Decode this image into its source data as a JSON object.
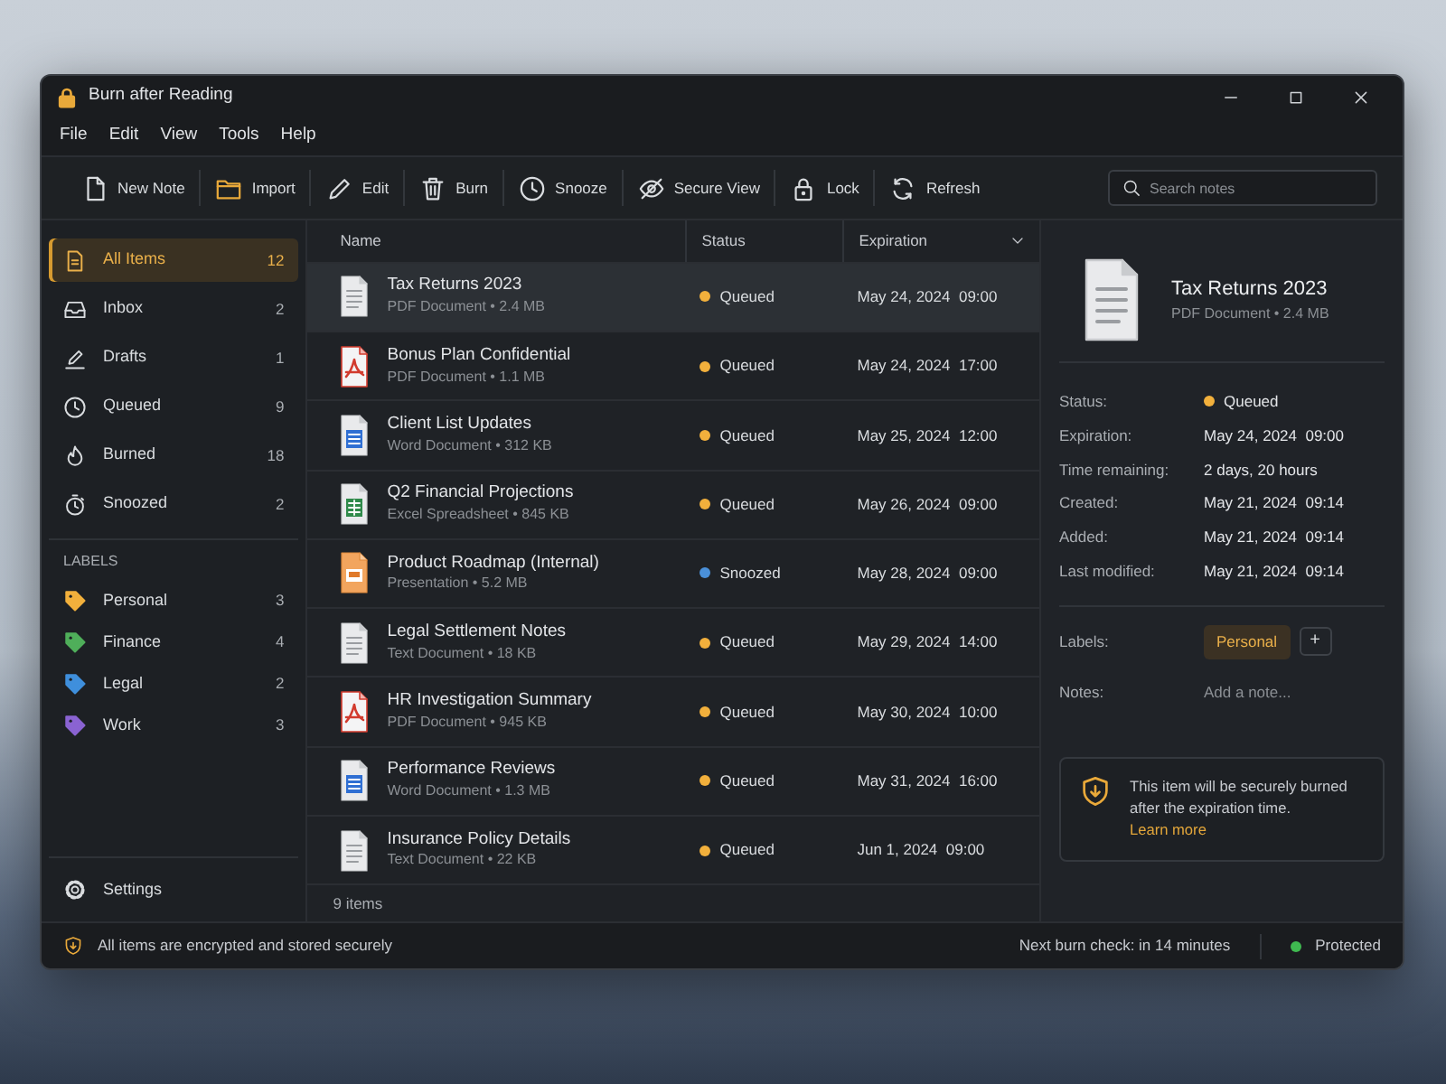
{
  "window": {
    "title": "Burn after Reading"
  },
  "menu": [
    "File",
    "Edit",
    "View",
    "Tools",
    "Help"
  ],
  "toolbar": [
    {
      "kind": "new",
      "label": "New Note"
    },
    {
      "kind": "import",
      "label": "Import"
    },
    {
      "kind": "edit",
      "label": "Edit"
    },
    {
      "kind": "burn",
      "label": "Burn"
    },
    {
      "kind": "snooze",
      "label": "Snooze"
    },
    {
      "kind": "secure",
      "label": "Secure View"
    },
    {
      "kind": "lock",
      "label": "Lock"
    },
    {
      "kind": "refresh",
      "label": "Refresh"
    }
  ],
  "search": {
    "placeholder": "Search notes"
  },
  "sidebar": {
    "items": [
      {
        "kind": "all",
        "label": "All Items",
        "count": "12",
        "selected": true
      },
      {
        "kind": "inbox",
        "label": "Inbox",
        "count": "2",
        "selected": false
      },
      {
        "kind": "drafts",
        "label": "Drafts",
        "count": "1",
        "selected": false
      },
      {
        "kind": "queued",
        "label": "Queued",
        "count": "9",
        "selected": false
      },
      {
        "kind": "burned",
        "label": "Burned",
        "count": "18",
        "selected": false
      },
      {
        "kind": "snoozed",
        "label": "Snoozed",
        "count": "2",
        "selected": false
      }
    ],
    "labels_heading": "LABELS",
    "labels": [
      {
        "label": "Personal",
        "count": "3",
        "color": "#f2b03c"
      },
      {
        "label": "Finance",
        "count": "4",
        "color": "#4fae5a"
      },
      {
        "label": "Legal",
        "count": "2",
        "color": "#3f8fdc"
      },
      {
        "label": "Work",
        "count": "3",
        "color": "#8a63d2"
      }
    ],
    "settings": "Settings"
  },
  "table": {
    "columns": [
      "Name",
      "Status",
      "Expiration"
    ],
    "rows": [
      {
        "kind": "plain",
        "name": "Tax Returns 2023",
        "meta": "PDF Document • 2.4 MB",
        "status": "Queued",
        "color": "#f2b03c",
        "expiration": "May 24, 2024  09:00",
        "selected": true
      },
      {
        "kind": "pdf",
        "name": "Bonus Plan Confidential",
        "meta": "PDF Document • 1.1 MB",
        "status": "Queued",
        "color": "#f2b03c",
        "expiration": "May 24, 2024  17:00",
        "selected": false
      },
      {
        "kind": "word",
        "name": "Client List Updates",
        "meta": "Word Document • 312 KB",
        "status": "Queued",
        "color": "#f2b03c",
        "expiration": "May 25, 2024  12:00",
        "selected": false
      },
      {
        "kind": "excel",
        "name": "Q2 Financial Projections",
        "meta": "Excel Spreadsheet • 845 KB",
        "status": "Queued",
        "color": "#f2b03c",
        "expiration": "May 26, 2024  09:00",
        "selected": false
      },
      {
        "kind": "slides",
        "name": "Product Roadmap (Internal)",
        "meta": "Presentation • 5.2 MB",
        "status": "Snoozed",
        "color": "#4a90d9",
        "expiration": "May 28, 2024  09:00",
        "selected": false
      },
      {
        "kind": "plain",
        "name": "Legal Settlement Notes",
        "meta": "Text Document • 18 KB",
        "status": "Queued",
        "color": "#f2b03c",
        "expiration": "May 29, 2024  14:00",
        "selected": false
      },
      {
        "kind": "pdf",
        "name": "HR Investigation Summary",
        "meta": "PDF Document • 945 KB",
        "status": "Queued",
        "color": "#f2b03c",
        "expiration": "May 30, 2024  10:00",
        "selected": false
      },
      {
        "kind": "word",
        "name": "Performance Reviews",
        "meta": "Word Document • 1.3 MB",
        "status": "Queued",
        "color": "#f2b03c",
        "expiration": "May 31, 2024  16:00",
        "selected": false
      },
      {
        "kind": "plain",
        "name": "Insurance Policy Details",
        "meta": "Text Document • 22 KB",
        "status": "Queued",
        "color": "#f2b03c",
        "expiration": "Jun 1, 2024  09:00",
        "selected": false
      }
    ],
    "footer": "9 items"
  },
  "details": {
    "kind": "plain",
    "title": "Tax Returns 2023",
    "meta": "PDF Document • 2.4 MB",
    "fields": [
      {
        "label": "Status:",
        "value": "Queued",
        "color": "#f2b03c"
      },
      {
        "label": "Expiration:",
        "value": "May 24, 2024  09:00"
      },
      {
        "label": "Time remaining:",
        "value": "2 days, 20 hours"
      },
      {
        "label": "Created:",
        "value": "May 21, 2024  09:14"
      },
      {
        "label": "Added:",
        "value": "May 21, 2024  09:14"
      },
      {
        "label": "Last modified:",
        "value": "May 21, 2024  09:14"
      }
    ],
    "labels_label": "Labels:",
    "labels": [
      "Personal"
    ],
    "add_label": "+",
    "notes_label": "Notes:",
    "notes_placeholder": "Add a note...",
    "notice": {
      "text": "This item will be securely burned after the expiration time.",
      "link": "Learn more"
    }
  },
  "status_bar": {
    "message": "All items are encrypted and stored securely",
    "next_check": "Next burn check: in 14 minutes",
    "protection": "Protected"
  }
}
